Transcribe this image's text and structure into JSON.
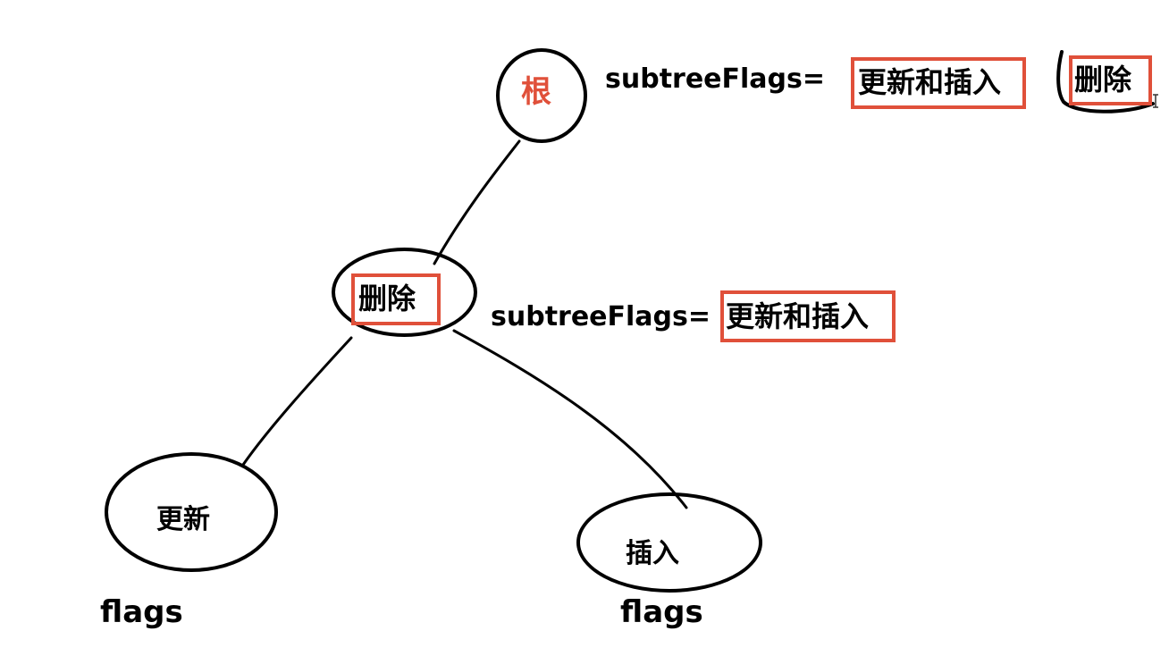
{
  "colors": {
    "highlight_border": "#e0503a",
    "root_text": "#e0503a",
    "ink": "#000000",
    "background": "#ffffff"
  },
  "root": {
    "label": "根",
    "subtree_flags_key": "subtreeFlags=",
    "subtree_flags_value_1": "更新和插入",
    "subtree_flags_value_2": "删除"
  },
  "middle": {
    "label": "删除",
    "subtree_flags_key": "subtreeFlags=",
    "subtree_flags_value": "更新和插入"
  },
  "left_leaf": {
    "label": "更新",
    "caption": "flags"
  },
  "right_leaf": {
    "label": "插入",
    "caption": "flags"
  }
}
